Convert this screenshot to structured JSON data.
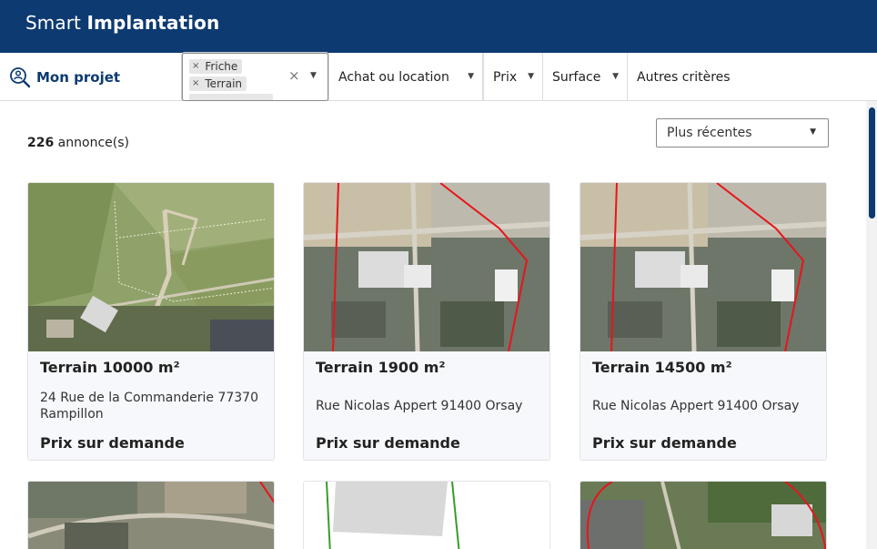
{
  "header": {
    "brand_light": "Smart ",
    "brand_bold": "Implantation"
  },
  "filters": {
    "projet_label": "Mon projet",
    "tags": [
      {
        "remove": "×",
        "label": "Friche"
      },
      {
        "remove": "×",
        "label": "Terrain"
      }
    ],
    "clear_symbol": "×",
    "arrow": "▼",
    "achat": "Achat ou location",
    "prix": "Prix",
    "surface": "Surface",
    "autres": "Autres critères"
  },
  "results": {
    "count": "226",
    "count_suffix": " annonce(s)"
  },
  "sort": {
    "selected": "Plus récentes"
  },
  "cards": [
    {
      "title": "Terrain 10000 m²",
      "address": "24 Rue de la Commanderie 77370 Rampillon",
      "price": "Prix sur demande"
    },
    {
      "title": "Terrain 1900 m²",
      "address": "Rue Nicolas Appert 91400 Orsay",
      "price": "Prix sur demande"
    },
    {
      "title": "Terrain 14500 m²",
      "address": "Rue Nicolas Appert 91400 Orsay",
      "price": "Prix sur demande"
    }
  ],
  "colors": {
    "brand": "#0d3a70",
    "parcel_line": "#e8141b",
    "card_bg": "#f7f8fb"
  }
}
